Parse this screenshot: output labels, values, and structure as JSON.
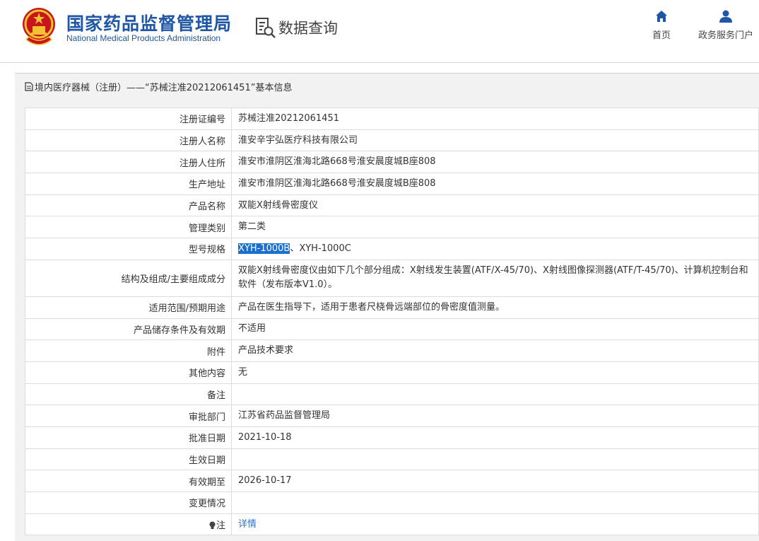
{
  "header": {
    "logo_cn": "国家药品监督管理局",
    "logo_en": "National Medical Products Administration",
    "query_title": "数据查询",
    "nav": [
      {
        "label": "首页",
        "icon": "home-icon"
      },
      {
        "label": "政务服务门户",
        "icon": "user-icon"
      }
    ]
  },
  "breadcrumb": "境内医疗器械（注册）——“苏械注准20212061451”基本信息",
  "colors": {
    "brand": "#1f57a6",
    "link": "#2a72c8",
    "selection": "#1a6fd1"
  },
  "rows": [
    {
      "label": "注册证编号",
      "value": "苏械注准20212061451"
    },
    {
      "label": "注册人名称",
      "value": "淮安辛宇弘医疗科技有限公司"
    },
    {
      "label": "注册人住所",
      "value": "淮安市淮阴区淮海北路668号淮安晨度城B座808"
    },
    {
      "label": "生产地址",
      "value": "淮安市淮阴区淮海北路668号淮安晨度城B座808"
    },
    {
      "label": "产品名称",
      "value": "双能X射线骨密度仪"
    },
    {
      "label": "管理类别",
      "value": "第二类"
    },
    {
      "label": "型号规格",
      "value_selected": "XYH-1000B",
      "value_rest": "、XYH-1000C"
    },
    {
      "label": "结构及组成/主要组成成分",
      "value": "双能X射线骨密度仪由如下几个部分组成：X射线发生装置(ATF/X-45/70)、X射线图像探测器(ATF/T-45/70)、计算机控制台和软件（发布版本V1.0）。"
    },
    {
      "label": "适用范围/预期用途",
      "value": "产品在医生指导下，适用于患者尺桡骨远端部位的骨密度值测量。"
    },
    {
      "label": "产品储存条件及有效期",
      "value": "不适用"
    },
    {
      "label": "附件",
      "value": "产品技术要求"
    },
    {
      "label": "其他内容",
      "value": "无"
    },
    {
      "label": "备注",
      "value": ""
    },
    {
      "label": "审批部门",
      "value": "江苏省药品监督管理局"
    },
    {
      "label": "批准日期",
      "value": "2021-10-18"
    },
    {
      "label": "生效日期",
      "value": ""
    },
    {
      "label": "有效期至",
      "value": "2026-10-17"
    },
    {
      "label": "变更情况",
      "value": ""
    },
    {
      "label": "注",
      "value": "详情"
    }
  ]
}
